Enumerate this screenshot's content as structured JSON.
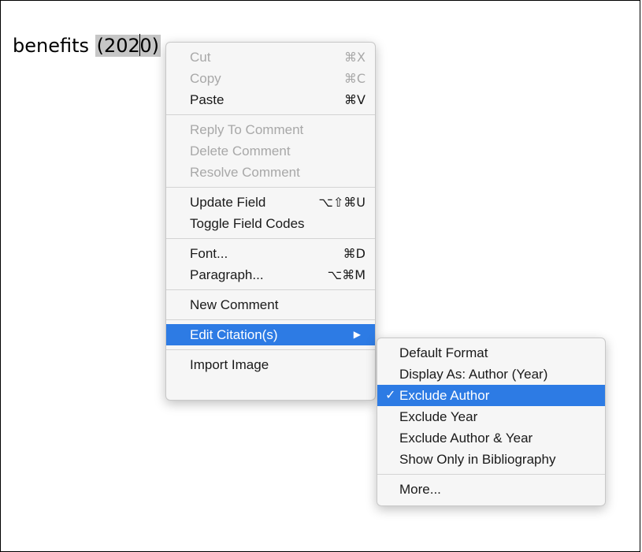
{
  "document": {
    "text_before": "benefits ",
    "field_part1": "(202",
    "field_part2": "0)"
  },
  "context_menu": {
    "cut": {
      "label": "Cut",
      "shortcut": "⌘X"
    },
    "copy": {
      "label": "Copy",
      "shortcut": "⌘C"
    },
    "paste": {
      "label": "Paste",
      "shortcut": "⌘V"
    },
    "reply_comment": {
      "label": "Reply To Comment"
    },
    "delete_comment": {
      "label": "Delete Comment"
    },
    "resolve_comment": {
      "label": "Resolve Comment"
    },
    "update_field": {
      "label": "Update Field",
      "shortcut": "⌥⇧⌘U"
    },
    "toggle_field_codes": {
      "label": "Toggle Field Codes"
    },
    "font": {
      "label": "Font...",
      "shortcut": "⌘D"
    },
    "paragraph": {
      "label": "Paragraph...",
      "shortcut": "⌥⌘M"
    },
    "new_comment": {
      "label": "New Comment"
    },
    "edit_citations": {
      "label": "Edit Citation(s)",
      "arrow": "▶"
    },
    "import_image": {
      "label": "Import Image"
    }
  },
  "submenu": {
    "default_format": "Default Format",
    "display_as": "Display As: Author (Year)",
    "exclude_author": "Exclude Author",
    "exclude_author_check": "✓",
    "exclude_year": "Exclude Year",
    "exclude_author_year": "Exclude Author & Year",
    "show_only_bibliography": "Show Only in Bibliography",
    "more": "More..."
  },
  "colors": {
    "highlight": "#2d7be4",
    "field_shading": "#c6c6c6",
    "disabled_text": "#a8a8a8"
  }
}
